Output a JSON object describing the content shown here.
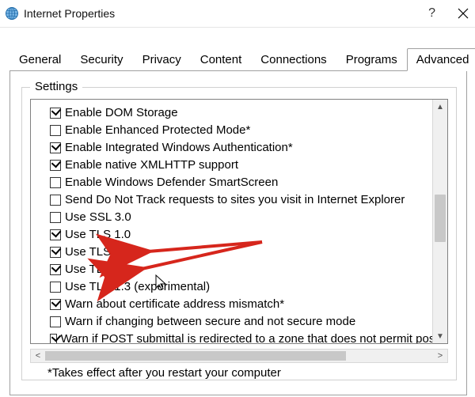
{
  "window": {
    "title": "Internet Properties"
  },
  "tabs": [
    "General",
    "Security",
    "Privacy",
    "Content",
    "Connections",
    "Programs",
    "Advanced"
  ],
  "active_tab_index": 6,
  "group_label": "Settings",
  "settings": [
    {
      "label": "Enable DOM Storage",
      "checked": true
    },
    {
      "label": "Enable Enhanced Protected Mode*",
      "checked": false
    },
    {
      "label": "Enable Integrated Windows Authentication*",
      "checked": true
    },
    {
      "label": "Enable native XMLHTTP support",
      "checked": true
    },
    {
      "label": "Enable Windows Defender SmartScreen",
      "checked": false
    },
    {
      "label": "Send Do Not Track requests to sites you visit in Internet Explorer",
      "checked": false
    },
    {
      "label": "Use SSL 3.0",
      "checked": false
    },
    {
      "label": "Use TLS 1.0",
      "checked": true
    },
    {
      "label": "Use TLS 1.1",
      "checked": true
    },
    {
      "label": "Use TLS 1.2",
      "checked": true
    },
    {
      "label": "Use TLS 1.3 (experimental)",
      "checked": false
    },
    {
      "label": "Warn about certificate address mismatch*",
      "checked": true
    },
    {
      "label": "Warn if changing between secure and not secure mode",
      "checked": false
    },
    {
      "label": "Warn if POST submittal is redirected to a zone that does not permit posts",
      "checked": true
    }
  ],
  "note": "*Takes effect after you restart your computer",
  "highlighted_settings": [
    "Use TLS 1.1",
    "Use TLS 1.2"
  ]
}
